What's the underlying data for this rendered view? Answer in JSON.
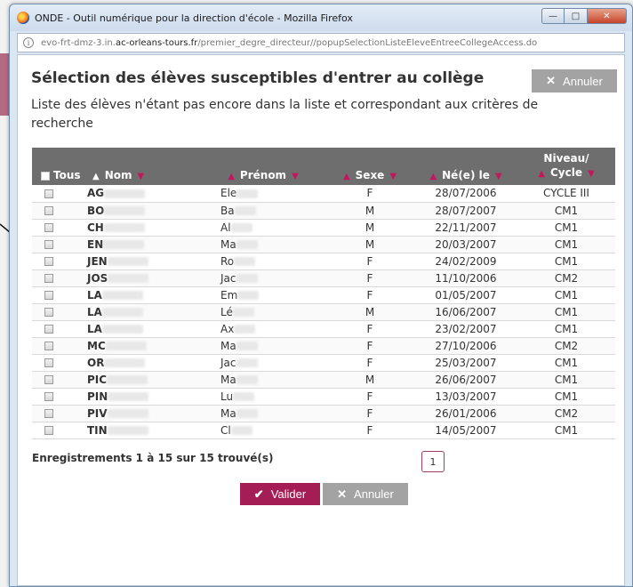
{
  "window": {
    "title": "ONDE - Outil numérique pour la direction d'école - Mozilla Firefox",
    "url_prefix": "evo-frt-dmz-3.in.",
    "url_host": "ac-orleans-tours.fr",
    "url_path": "/premier_degre_directeur//popupSelectionListeEleveEntreeCollegeAccess.do",
    "minimize": "—",
    "maximize": "□",
    "close": "✕"
  },
  "dialog": {
    "title": "Sélection des élèves susceptibles d'entrer au collège",
    "cancel_label": "Annuler",
    "subtitle": "Liste des élèves n'étant pas encore dans la liste et correspondant aux critères de recherche"
  },
  "table": {
    "headers": {
      "tous": "Tous",
      "nom": "Nom",
      "prenom": "Prénom",
      "sexe": "Sexe",
      "naissance": "Né(e) le",
      "niveau_line1": "Niveau/",
      "niveau_line2": "Cycle"
    },
    "rows": [
      {
        "nom": "AG",
        "prenom": "Ele",
        "sexe": "F",
        "naissance": "28/07/2006",
        "niveau": "CYCLE III"
      },
      {
        "nom": "BO",
        "prenom": "Ba",
        "sexe": "M",
        "naissance": "28/07/2007",
        "niveau": "CM1"
      },
      {
        "nom": "CH",
        "prenom": "Al",
        "sexe": "M",
        "naissance": "22/11/2007",
        "niveau": "CM1"
      },
      {
        "nom": "EN",
        "prenom": "Ma",
        "sexe": "M",
        "naissance": "20/03/2007",
        "niveau": "CM1"
      },
      {
        "nom": "JEN",
        "prenom": "Ro",
        "sexe": "F",
        "naissance": "24/02/2009",
        "niveau": "CM1"
      },
      {
        "nom": "JOS",
        "prenom": "Jac",
        "sexe": "F",
        "naissance": "11/10/2006",
        "niveau": "CM2"
      },
      {
        "nom": "LA",
        "prenom": "Em",
        "sexe": "F",
        "naissance": "01/05/2007",
        "niveau": "CM1"
      },
      {
        "nom": "LA",
        "prenom": "Lé",
        "sexe": "M",
        "naissance": "16/06/2007",
        "niveau": "CM1"
      },
      {
        "nom": "LA",
        "prenom": "Ax",
        "sexe": "F",
        "naissance": "23/02/2007",
        "niveau": "CM1"
      },
      {
        "nom": "MC",
        "prenom": "Ma",
        "sexe": "F",
        "naissance": "27/10/2006",
        "niveau": "CM2"
      },
      {
        "nom": "OR",
        "prenom": "Jac",
        "sexe": "F",
        "naissance": "25/03/2007",
        "niveau": "CM1"
      },
      {
        "nom": "PIC",
        "prenom": "Ma",
        "sexe": "M",
        "naissance": "26/06/2007",
        "niveau": "CM1"
      },
      {
        "nom": "PIN",
        "prenom": "Lu",
        "sexe": "F",
        "naissance": "13/03/2007",
        "niveau": "CM1"
      },
      {
        "nom": "PIV",
        "prenom": "Ma",
        "sexe": "F",
        "naissance": "26/01/2006",
        "niveau": "CM2"
      },
      {
        "nom": "TIN",
        "prenom": "Cl",
        "sexe": "F",
        "naissance": "14/05/2007",
        "niveau": "CM1"
      }
    ]
  },
  "footer": {
    "count_text": "Enregistrements 1 à 15 sur 15 trouvé(s)",
    "page": "1",
    "valider_label": "Valider",
    "annuler_label": "Annuler"
  },
  "colors": {
    "accent": "#a51d55",
    "header_bg": "#6e6e6e",
    "button_grey": "#a3a3a3"
  }
}
